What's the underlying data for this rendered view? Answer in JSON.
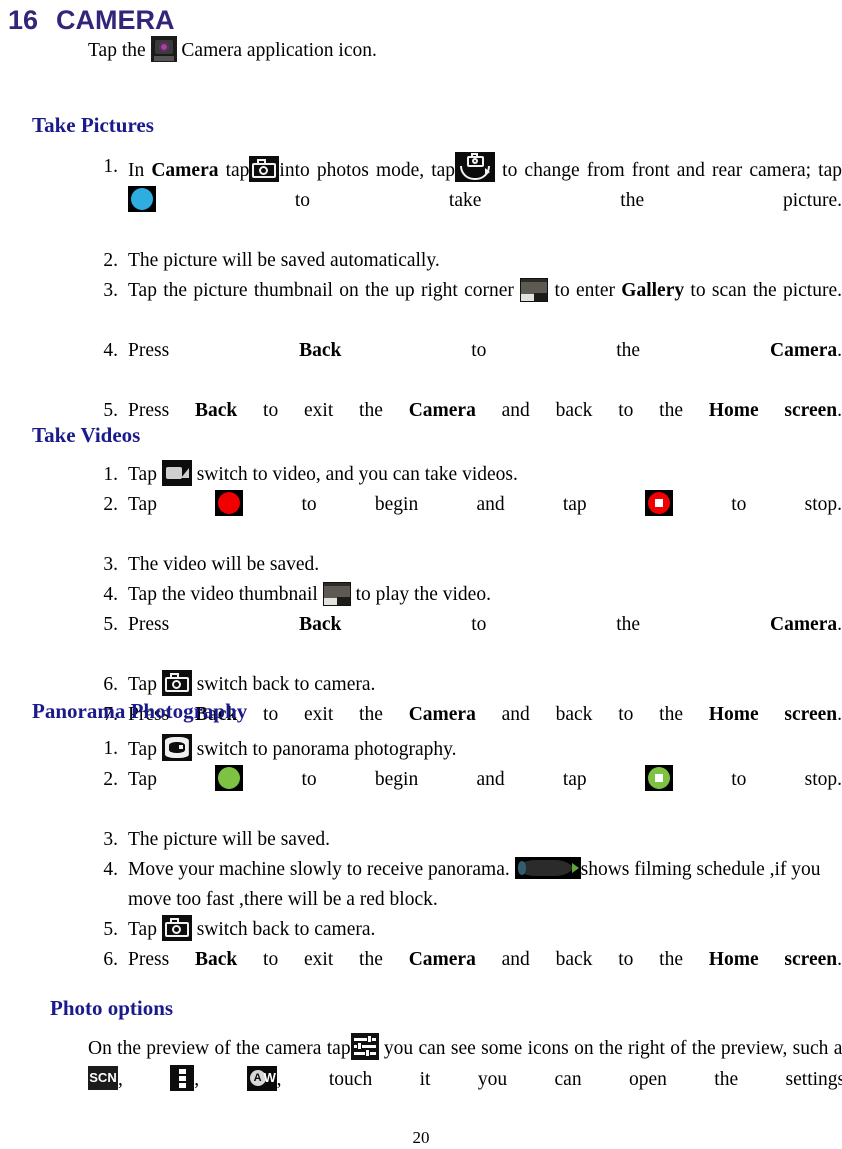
{
  "document": {
    "chapter_number": "16",
    "chapter_title": "CAMERA",
    "page_number": "20",
    "heading_color": "#1a1a8c",
    "chapter_color": "#33267a"
  },
  "intro": {
    "before_icon": "Tap the",
    "icon": "camera-app-icon",
    "after_icon": "Camera application icon."
  },
  "sections": [
    {
      "id": "take-pictures",
      "heading": "Take Pictures",
      "steps": [
        {
          "marker": "1.",
          "parts": [
            {
              "type": "text",
              "value": "In "
            },
            {
              "type": "bold",
              "value": "Camera"
            },
            {
              "type": "text",
              "value": "  tap"
            },
            {
              "type": "icon",
              "value": "photo-mode-icon"
            },
            {
              "type": "text",
              "value": "into photos mode, tap"
            },
            {
              "type": "icon",
              "value": "switch-camera-icon"
            },
            {
              "type": "text",
              "value": " to change from front and rear camera; tap "
            },
            {
              "type": "icon",
              "value": "shutter-button-icon"
            },
            {
              "type": "text",
              "value": " to take the picture."
            }
          ]
        },
        {
          "marker": "2.",
          "parts": [
            {
              "type": "text",
              "value": "The picture will be saved automatically."
            }
          ]
        },
        {
          "marker": "3.",
          "parts": [
            {
              "type": "text",
              "value": "Tap the picture thumbnail on the up right corner "
            },
            {
              "type": "icon",
              "value": "photo-thumbnail-icon"
            },
            {
              "type": "text",
              "value": " to enter "
            },
            {
              "type": "bold",
              "value": "Gallery"
            },
            {
              "type": "text",
              "value": " to scan the picture."
            }
          ]
        },
        {
          "marker": "4.",
          "parts": [
            {
              "type": "text",
              "value": "Press "
            },
            {
              "type": "bold",
              "value": "Back"
            },
            {
              "type": "text",
              "value": " to the "
            },
            {
              "type": "bold",
              "value": "Camera"
            },
            {
              "type": "text",
              "value": "."
            }
          ]
        },
        {
          "marker": "5.",
          "parts": [
            {
              "type": "text",
              "value": "Press "
            },
            {
              "type": "bold",
              "value": "Back"
            },
            {
              "type": "text",
              "value": " to exit the "
            },
            {
              "type": "bold",
              "value": "Camera"
            },
            {
              "type": "text",
              "value": " and back to the "
            },
            {
              "type": "bold",
              "value": "Home screen"
            },
            {
              "type": "text",
              "value": "."
            }
          ]
        }
      ]
    },
    {
      "id": "take-videos",
      "heading": "Take Videos",
      "steps": [
        {
          "marker": "1.",
          "parts": [
            {
              "type": "text",
              "value": "Tap "
            },
            {
              "type": "icon",
              "value": "video-mode-icon"
            },
            {
              "type": "text",
              "value": " switch to video, and you can take videos."
            }
          ]
        },
        {
          "marker": "2.",
          "parts": [
            {
              "type": "text",
              "value": "Tap "
            },
            {
              "type": "icon",
              "value": "record-button-icon"
            },
            {
              "type": "text",
              "value": " to begin and tap "
            },
            {
              "type": "icon",
              "value": "stop-button-icon"
            },
            {
              "type": "text",
              "value": "  to stop."
            }
          ]
        },
        {
          "marker": "3.",
          "parts": [
            {
              "type": "text",
              "value": "The video will be saved."
            }
          ]
        },
        {
          "marker": "4.",
          "parts": [
            {
              "type": "text",
              "value": "Tap the video thumbnail "
            },
            {
              "type": "icon",
              "value": "video-thumbnail-icon"
            },
            {
              "type": "text",
              "value": "  to play the video."
            }
          ]
        },
        {
          "marker": "5.",
          "parts": [
            {
              "type": "text",
              "value": "Press "
            },
            {
              "type": "bold",
              "value": "Back"
            },
            {
              "type": "text",
              "value": " to the "
            },
            {
              "type": "bold",
              "value": "Camera"
            },
            {
              "type": "text",
              "value": "."
            }
          ]
        },
        {
          "marker": "6.",
          "parts": [
            {
              "type": "text",
              "value": "Tap "
            },
            {
              "type": "icon",
              "value": "photo-mode-icon"
            },
            {
              "type": "text",
              "value": "  switch back to camera."
            }
          ]
        },
        {
          "marker": "7.",
          "parts": [
            {
              "type": "text",
              "value": "Press "
            },
            {
              "type": "bold",
              "value": "Back"
            },
            {
              "type": "text",
              "value": " to exit the "
            },
            {
              "type": "bold",
              "value": "Camera"
            },
            {
              "type": "text",
              "value": " and back to the "
            },
            {
              "type": "bold",
              "value": "Home screen"
            },
            {
              "type": "text",
              "value": "."
            }
          ]
        }
      ]
    },
    {
      "id": "panorama",
      "heading": "Panorama Photography",
      "steps": [
        {
          "marker": "1.",
          "parts": [
            {
              "type": "text",
              "value": "Tap "
            },
            {
              "type": "icon",
              "value": "panorama-mode-icon"
            },
            {
              "type": "text",
              "value": "  switch to panorama photography."
            }
          ]
        },
        {
          "marker": "2.",
          "parts": [
            {
              "type": "text",
              "value": "Tap "
            },
            {
              "type": "icon",
              "value": "record-green-icon"
            },
            {
              "type": "text",
              "value": "  to begin and tap "
            },
            {
              "type": "icon",
              "value": "stop-green-icon"
            },
            {
              "type": "text",
              "value": "  to stop."
            }
          ]
        },
        {
          "marker": "3.",
          "parts": [
            {
              "type": "text",
              "value": "The picture will be saved."
            }
          ]
        },
        {
          "marker": "4.",
          "parts": [
            {
              "type": "text",
              "value": "Move your machine slowly to receive panorama.  "
            },
            {
              "type": "icon",
              "value": "filming-schedule-bar-icon"
            },
            {
              "type": "text",
              "value": "shows filming schedule ,if you move too fast ,there will be a red block."
            }
          ]
        },
        {
          "marker": "5.",
          "parts": [
            {
              "type": "text",
              "value": "Tap "
            },
            {
              "type": "icon",
              "value": "photo-mode-icon"
            },
            {
              "type": "text",
              "value": "  switch back to camera."
            }
          ]
        },
        {
          "marker": "6.",
          "parts": [
            {
              "type": "text",
              "value": "Press "
            },
            {
              "type": "bold",
              "value": "Back"
            },
            {
              "type": "text",
              "value": " to exit the "
            },
            {
              "type": "bold",
              "value": "Camera"
            },
            {
              "type": "text",
              "value": " and back to the "
            },
            {
              "type": "bold",
              "value": "Home screen"
            },
            {
              "type": "text",
              "value": "."
            }
          ]
        }
      ]
    },
    {
      "id": "photo-options",
      "heading": "Photo options",
      "paragraph": [
        {
          "type": "text",
          "value": "On the   preview of the camera  tap"
        },
        {
          "type": "icon",
          "value": "settings-sliders-icon"
        },
        {
          "type": "text",
          "value": "  you can see some icons on the right of the preview,   such as "
        },
        {
          "type": "icon",
          "value": "scene-mode-icon"
        },
        {
          "type": "text",
          "value": ",  "
        },
        {
          "type": "icon",
          "value": "more-options-icon"
        },
        {
          "type": "text",
          "value": ",  "
        },
        {
          "type": "icon",
          "value": "white-balance-icon"
        },
        {
          "type": "text",
          "value": ",   touch it you can open the settings."
        }
      ]
    }
  ],
  "icon_labels": {
    "scene_mode_text": "SCN",
    "white_balance_circle_text": "A",
    "white_balance_suffix_text": "W"
  }
}
